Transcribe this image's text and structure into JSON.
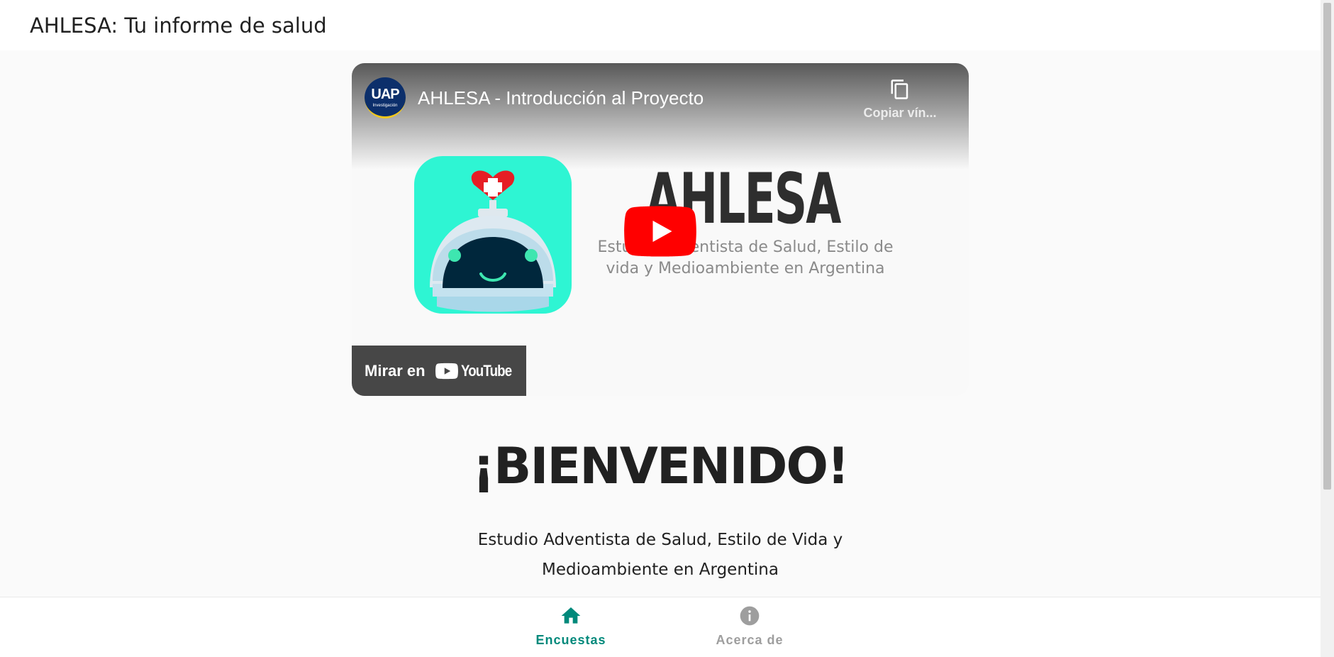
{
  "header": {
    "title": "AHLESA: Tu informe de salud"
  },
  "video": {
    "channel": {
      "brand": "UAP",
      "sub": "Investigación"
    },
    "title": "AHLESA - Introducción al Proyecto",
    "copy_link_label": "Copiar vín...",
    "wordmark": "AHLESA",
    "tagline": "Estudio Adventista de Salud, Estilo de vida y Medioambiente en Argentina",
    "watch_on_label": "Mirar en",
    "youtube_word": "YouTube",
    "colors": {
      "play_red": "#ff0000",
      "robot_bg": "#2ef5d3",
      "heart": "#e61e25"
    }
  },
  "welcome": {
    "heading": "¡BIENVENIDO!",
    "subtitle": "Estudio Adventista de Salud, Estilo de Vida y Medioambiente en Argentina"
  },
  "bottom_nav": {
    "items": [
      {
        "label": "Encuestas",
        "icon": "home-icon",
        "active": true
      },
      {
        "label": "Acerca de",
        "icon": "info-icon",
        "active": false
      }
    ],
    "accent": "#00897b"
  }
}
